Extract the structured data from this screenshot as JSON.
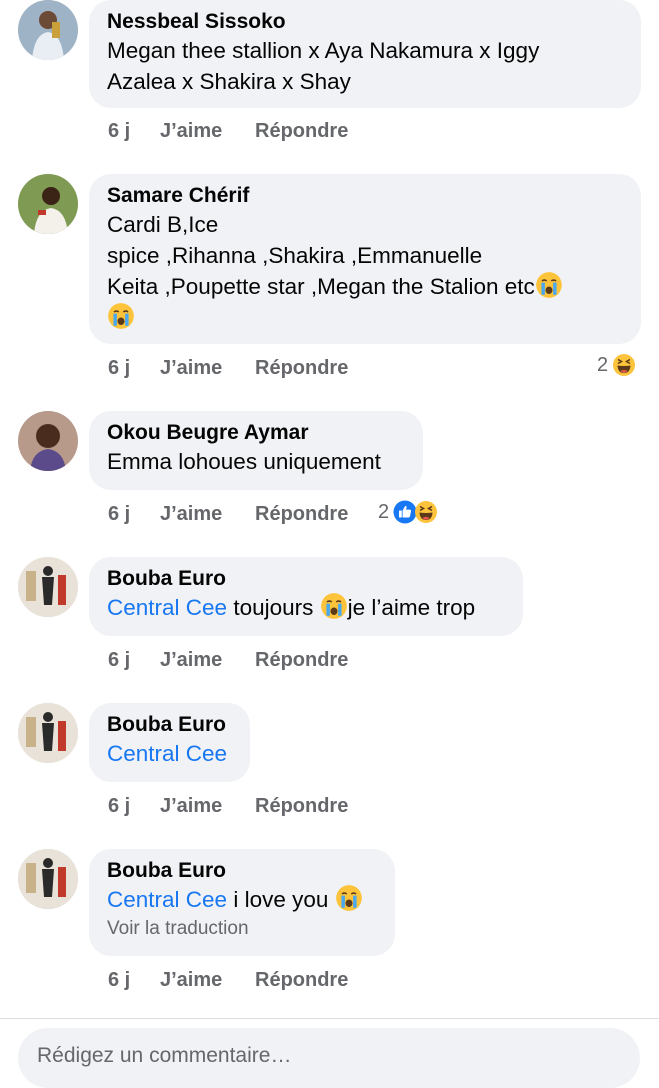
{
  "comments": [
    {
      "author": "Nessbeal Sissoko",
      "lines": [
        "Megan thee stallion x Aya Nakamura x Iggy",
        "Azalea x Shakira x Shay"
      ],
      "time": "6 j",
      "like": "J’aime",
      "reply": "Répondre"
    },
    {
      "author": "Samare Chérif",
      "lines": [
        "Cardi B,Ice",
        "spice ,Rihanna ,Shakira ,Emmanuelle",
        "Keita ,Poupette star ,Megan the Stalion etc"
      ],
      "time": "6 j",
      "like": "J’aime",
      "reply": "Répondre",
      "reaction_count": "2",
      "reaction_icons": [
        "haha-icon"
      ]
    },
    {
      "author": "Okou Beugre Aymar",
      "lines": [
        "Emma lohoues uniquement"
      ],
      "time": "6 j",
      "like": "J’aime",
      "reply": "Répondre",
      "reaction_count": "2",
      "reaction_icons": [
        "like-icon",
        "haha-icon"
      ]
    },
    {
      "author": "Bouba Euro",
      "mention": "Central Cee",
      "text_a": " toujours ",
      "text_b": "je l’aime trop",
      "time": "6 j",
      "like": "J’aime",
      "reply": "Répondre"
    },
    {
      "author": "Bouba Euro",
      "mention": "Central Cee",
      "time": "6 j",
      "like": "J’aime",
      "reply": "Répondre"
    },
    {
      "author": "Bouba Euro",
      "mention": "Central Cee",
      "text_a": " i love you ",
      "translate": "Voir la traduction",
      "time": "6 j",
      "like": "J’aime",
      "reply": "Répondre"
    }
  ],
  "composer": {
    "placeholder": "Rédigez un commentaire…"
  },
  "colors": {
    "bubble": "#f0f2f5",
    "mention": "#1877f2",
    "meta": "#65676b",
    "like_blue": "#1877f2",
    "emoji_yellow": "#fdc33b"
  }
}
